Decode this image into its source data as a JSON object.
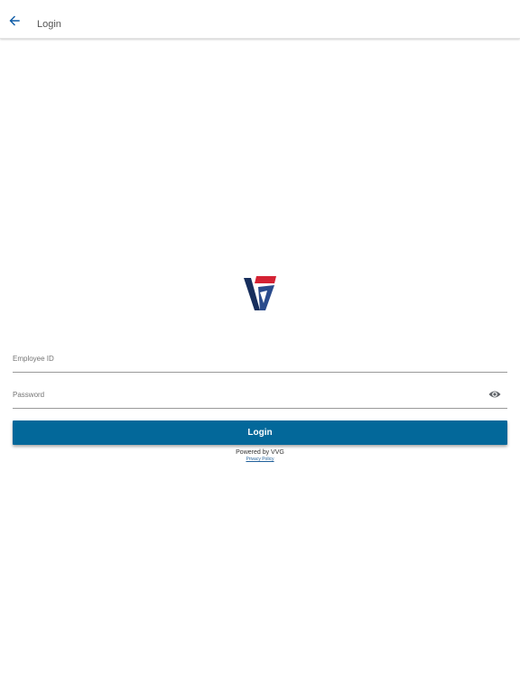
{
  "header": {
    "title": "Login",
    "back_icon": "arrow-left-icon"
  },
  "logo": {
    "name": "vvg-logo",
    "colors": {
      "red": "#d42233",
      "navy": "#172e5c",
      "blue": "#2a4b8c"
    }
  },
  "form": {
    "employee_id": {
      "placeholder": "Employee ID",
      "value": ""
    },
    "password": {
      "placeholder": "Password",
      "value": "",
      "toggle_icon": "eye-icon"
    },
    "login_label": "Login"
  },
  "footer": {
    "powered_by": "Powered by VVG",
    "privacy_label": "Privacy Policy"
  },
  "colors": {
    "accent": "#03689a",
    "icon_blue": "#0c5aa6",
    "link": "#1f5f9a"
  }
}
